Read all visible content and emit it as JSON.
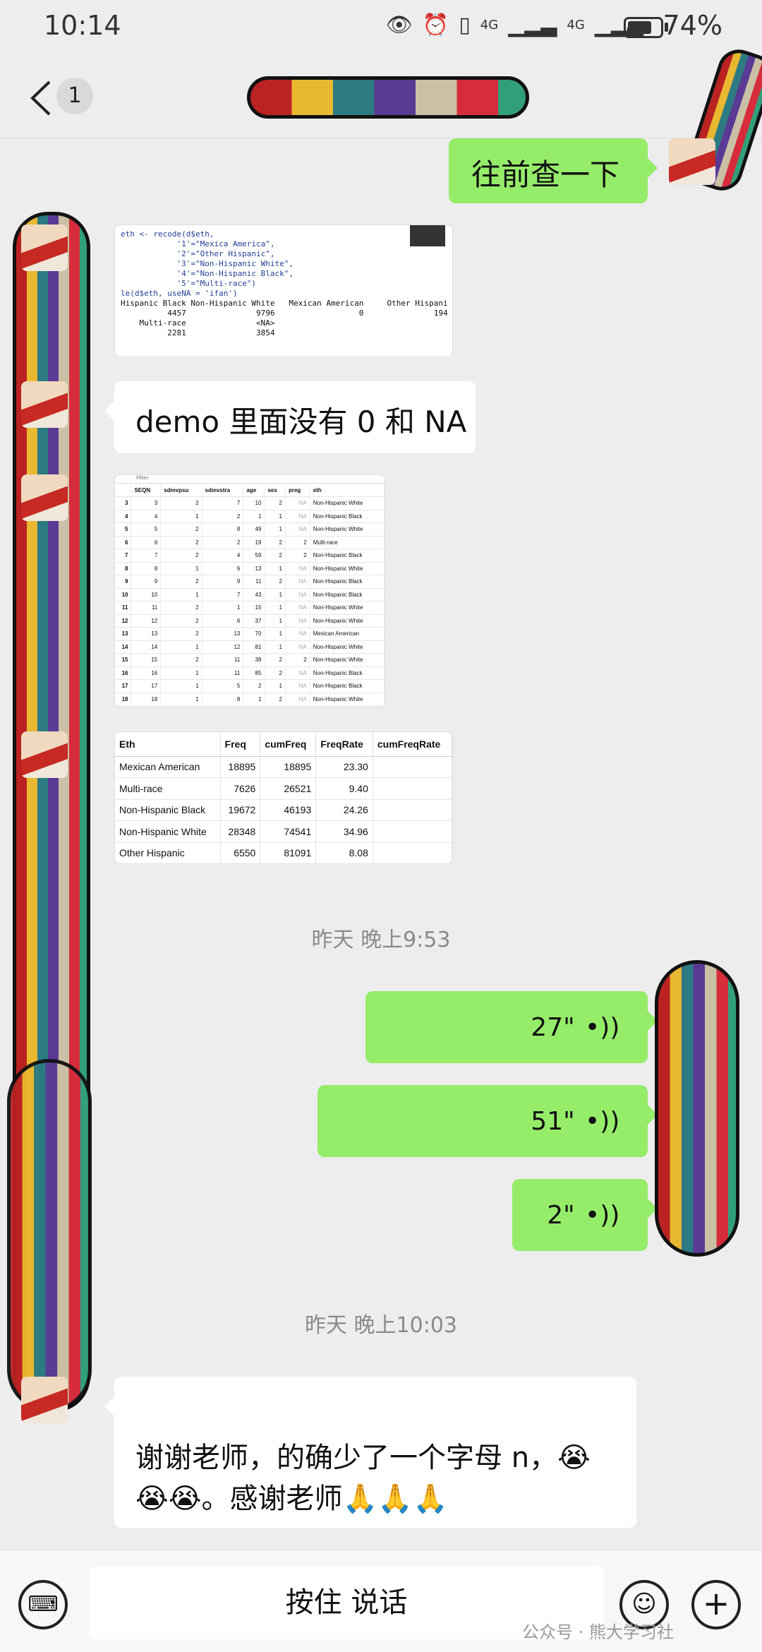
{
  "status_bar": {
    "time": "10:14",
    "signal1": "4G",
    "signal2": "4G",
    "battery": "74%",
    "battery_level": 0.74
  },
  "header": {
    "unread_count": "1"
  },
  "messages": {
    "m1": {
      "text": "往前查一下"
    },
    "code_image": {
      "lines": [
        "eth <- recode(d$eth,",
        "            '1'=\"Mexica America\",",
        "            '2'=\"Other Hispanic\",",
        "            '3'=\"Non-Hispanic White\",",
        "            '4'=\"Non-Hispanic Black\",",
        "            '5'=\"Multi-race\")",
        "le(d$eth, useNA = 'ifan')"
      ],
      "output": [
        "Hispanic Black Non-Hispanic White   Mexican American     Other Hispani",
        "          4457               9796                  0               194",
        "    Multi-race               <NA>",
        "          2281               3854"
      ]
    },
    "m2": {
      "text": "demo 里面没有 0 和 NA"
    },
    "data_image": {
      "filter": "Filter",
      "columns": [
        "SEQN",
        "sdmvpsu",
        "sdmvstra",
        "age",
        "sex",
        "preg",
        "eth"
      ],
      "rows": [
        [
          "3",
          "3",
          "2",
          "7",
          "10",
          "2",
          "NA",
          "Non-Hispanic White"
        ],
        [
          "4",
          "4",
          "1",
          "2",
          "1",
          "1",
          "NA",
          "Non-Hispanic Black"
        ],
        [
          "5",
          "5",
          "2",
          "8",
          "49",
          "1",
          "NA",
          "Non-Hispanic White"
        ],
        [
          "6",
          "6",
          "2",
          "2",
          "19",
          "2",
          "2",
          "Multi-race"
        ],
        [
          "7",
          "7",
          "2",
          "4",
          "59",
          "2",
          "2",
          "Non-Hispanic Black"
        ],
        [
          "8",
          "8",
          "1",
          "6",
          "13",
          "1",
          "NA",
          "Non-Hispanic White"
        ],
        [
          "9",
          "9",
          "2",
          "9",
          "11",
          "2",
          "NA",
          "Non-Hispanic Black"
        ],
        [
          "10",
          "10",
          "1",
          "7",
          "43",
          "1",
          "NA",
          "Non-Hispanic Black"
        ],
        [
          "11",
          "11",
          "2",
          "1",
          "15",
          "1",
          "NA",
          "Non-Hispanic White"
        ],
        [
          "12",
          "12",
          "2",
          "6",
          "37",
          "1",
          "NA",
          "Non-Hispanic White"
        ],
        [
          "13",
          "13",
          "2",
          "13",
          "70",
          "1",
          "NA",
          "Mexican American"
        ],
        [
          "14",
          "14",
          "1",
          "12",
          "81",
          "1",
          "NA",
          "Non-Hispanic White"
        ],
        [
          "15",
          "15",
          "2",
          "11",
          "38",
          "2",
          "2",
          "Non-Hispanic White"
        ],
        [
          "16",
          "16",
          "1",
          "11",
          "85",
          "2",
          "NA",
          "Non-Hispanic Black"
        ],
        [
          "17",
          "17",
          "1",
          "5",
          "2",
          "1",
          "NA",
          "Non-Hispanic Black"
        ],
        [
          "18",
          "18",
          "1",
          "8",
          "1",
          "2",
          "NA",
          "Non-Hispanic White"
        ]
      ]
    },
    "freq_image": {
      "columns": [
        "Eth",
        "Freq",
        "cumFreq",
        "FreqRate",
        "cumFreqRate"
      ],
      "rows": [
        [
          "Mexican American",
          "18895",
          "18895",
          "23.30",
          ""
        ],
        [
          "Multi-race",
          "7626",
          "26521",
          "9.40",
          ""
        ],
        [
          "Non-Hispanic Black",
          "19672",
          "46193",
          "24.26",
          ""
        ],
        [
          "Non-Hispanic White",
          "28348",
          "74541",
          "34.96",
          ""
        ],
        [
          "Other Hispanic",
          "6550",
          "81091",
          "8.08",
          ""
        ]
      ]
    },
    "ts1": "昨天 晚上9:53",
    "voice1": {
      "duration": "27\""
    },
    "voice2": {
      "duration": "51\""
    },
    "voice3": {
      "duration": "2\""
    },
    "ts2": "昨天 晚上10:03",
    "m3": {
      "line1": "谢谢老师，的确少了一个字母 n，😭",
      "line2": "😭😭。感谢老师🙏🙏🙏"
    }
  },
  "input_bar": {
    "hold_to_talk": "按住 说话",
    "watermark": "公众号 · 熊大学习社"
  }
}
